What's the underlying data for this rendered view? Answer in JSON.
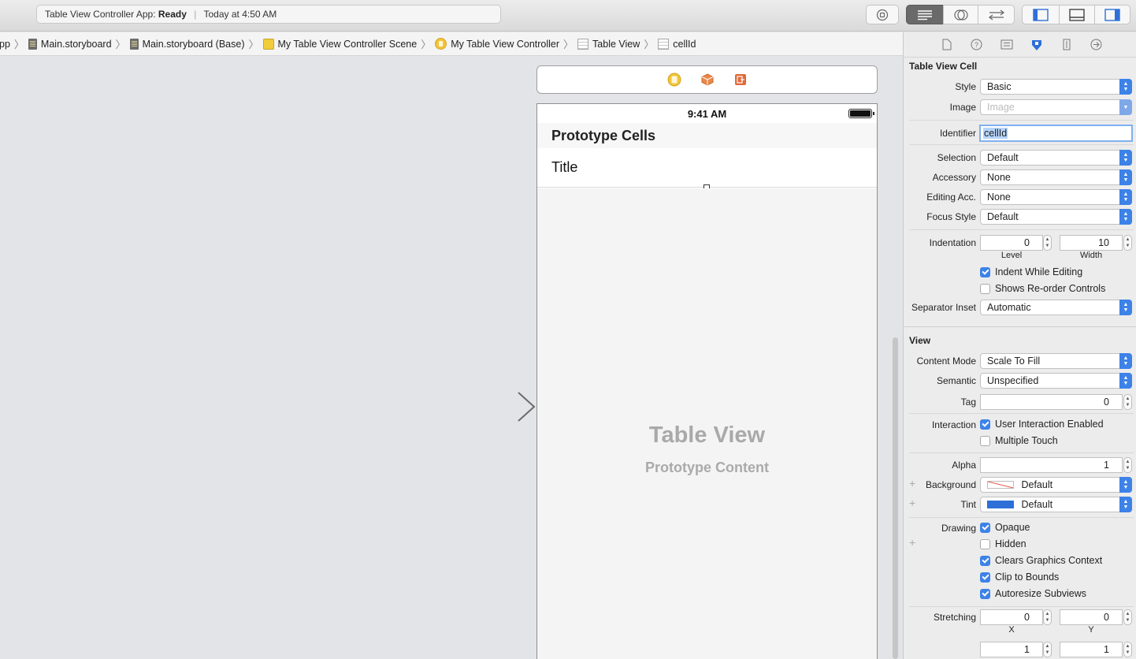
{
  "toolbar": {
    "activity_prefix": "Table View Controller App:",
    "activity_status": "Ready",
    "activity_time": "Today at 4:50 AM"
  },
  "jumpbar": {
    "items": [
      {
        "label": "pp",
        "icon": "file-icon"
      },
      {
        "label": "Main.storyboard",
        "icon": "storyboard-file-icon"
      },
      {
        "label": "Main.storyboard (Base)",
        "icon": "storyboard-file-icon"
      },
      {
        "label": "My Table View Controller Scene",
        "icon": "scene-icon"
      },
      {
        "label": "My Table View Controller",
        "icon": "view-controller-icon"
      },
      {
        "label": "Table View",
        "icon": "table-view-icon"
      },
      {
        "label": "cellId",
        "icon": "table-cell-icon"
      }
    ]
  },
  "canvas": {
    "status_time": "9:41 AM",
    "section_header": "Prototype Cells",
    "cell_title": "Title",
    "placeholder_title": "Table View",
    "placeholder_subtitle": "Prototype Content"
  },
  "inspector": {
    "table_view_cell": {
      "heading": "Table View Cell",
      "style_label": "Style",
      "style_value": "Basic",
      "image_label": "Image",
      "image_placeholder": "Image",
      "identifier_label": "Identifier",
      "identifier_value": "cellId",
      "selection_label": "Selection",
      "selection_value": "Default",
      "accessory_label": "Accessory",
      "accessory_value": "None",
      "editing_acc_label": "Editing Acc.",
      "editing_acc_value": "None",
      "focus_style_label": "Focus Style",
      "focus_style_value": "Default",
      "indentation_label": "Indentation",
      "level_value": "0",
      "level_label": "Level",
      "width_value": "10",
      "width_label": "Width",
      "indent_while_editing": "Indent While Editing",
      "shows_reorder": "Shows Re-order Controls",
      "separator_inset_label": "Separator Inset",
      "separator_inset_value": "Automatic"
    },
    "view": {
      "heading": "View",
      "content_mode_label": "Content Mode",
      "content_mode_value": "Scale To Fill",
      "semantic_label": "Semantic",
      "semantic_value": "Unspecified",
      "tag_label": "Tag",
      "tag_value": "0",
      "interaction_label": "Interaction",
      "user_interaction": "User Interaction Enabled",
      "multiple_touch": "Multiple Touch",
      "alpha_label": "Alpha",
      "alpha_value": "1",
      "background_label": "Background",
      "background_value": "Default",
      "tint_label": "Tint",
      "tint_value": "Default",
      "drawing_label": "Drawing",
      "opaque": "Opaque",
      "hidden": "Hidden",
      "clears_graphics": "Clears Graphics Context",
      "clip_to_bounds": "Clip to Bounds",
      "autoresize": "Autoresize Subviews",
      "stretching_label": "Stretching",
      "stretch_x": "0",
      "stretch_x_label": "X",
      "stretch_y": "0",
      "stretch_y_label": "Y",
      "stretch_w": "1",
      "stretch_h": "1"
    },
    "checkbox_states": {
      "indent_while_editing": true,
      "shows_reorder": false,
      "user_interaction": true,
      "multiple_touch": false,
      "opaque": true,
      "hidden": false,
      "clears_graphics": true,
      "clip_to_bounds": true,
      "autoresize": true
    }
  },
  "colors": {
    "accent": "#3d82e7",
    "tint_swatch": "#2e6fd8",
    "canvas_bg": "#e3e4e7"
  }
}
